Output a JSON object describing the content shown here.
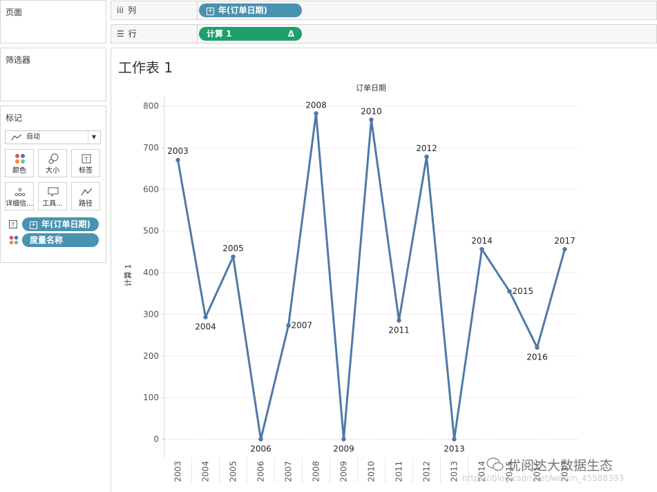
{
  "left": {
    "pages_title": "页面",
    "filters_title": "筛选器",
    "marks_title": "标记",
    "mark_type": "自动",
    "buttons": [
      {
        "label": "颜色",
        "icon": "color-dots-icon"
      },
      {
        "label": "大小",
        "icon": "size-icon"
      },
      {
        "label": "标签",
        "icon": "label-icon"
      },
      {
        "label": "详细信...",
        "icon": "detail-icon"
      },
      {
        "label": "工具...",
        "icon": "tooltip-icon"
      },
      {
        "label": "路径",
        "icon": "path-icon"
      }
    ],
    "fields": [
      {
        "label": "年(订单日期)",
        "icon": "label-icon",
        "plus": "⊞"
      },
      {
        "label": "度量名称",
        "icon": "color-dots-icon"
      }
    ]
  },
  "shelves": {
    "columns_label": "列",
    "columns_pill": "年(订单日期)",
    "rows_label": "行",
    "rows_pill": "计算 1",
    "rows_pill_delta": "Δ",
    "plus_glyph": "⊞"
  },
  "sheet_title": "工作表 1",
  "colors": {
    "line": "#4e79a7",
    "pill_blue": "#4a93b0",
    "pill_green": "#1da06b"
  },
  "chart_data": {
    "type": "line",
    "title": "订单日期",
    "ylabel": "计算 1",
    "xlabel": "",
    "categories": [
      "2003",
      "2004",
      "2005",
      "2006",
      "2007",
      "2008",
      "2009",
      "2010",
      "2011",
      "2012",
      "2013",
      "2014",
      "2015",
      "2016",
      "2017"
    ],
    "series": [
      {
        "values": [
          670,
          293,
          438,
          0,
          273,
          782,
          0,
          767,
          285,
          678,
          0,
          456,
          355,
          220,
          456
        ]
      }
    ],
    "data_labels": [
      "2003",
      "2004",
      "2005",
      "2006",
      "2007",
      "2008",
      "2009",
      "2010",
      "2011",
      "2012",
      "2013",
      "2014",
      "2015",
      "2016",
      "2017"
    ],
    "yticks": [
      0,
      100,
      200,
      300,
      400,
      500,
      600,
      700,
      800
    ],
    "ylim": [
      -40,
      840
    ],
    "grid": true
  },
  "watermark": {
    "text": "优阅达大数据生态",
    "url": "https://blog.csdn.net/weixin_45588393"
  }
}
